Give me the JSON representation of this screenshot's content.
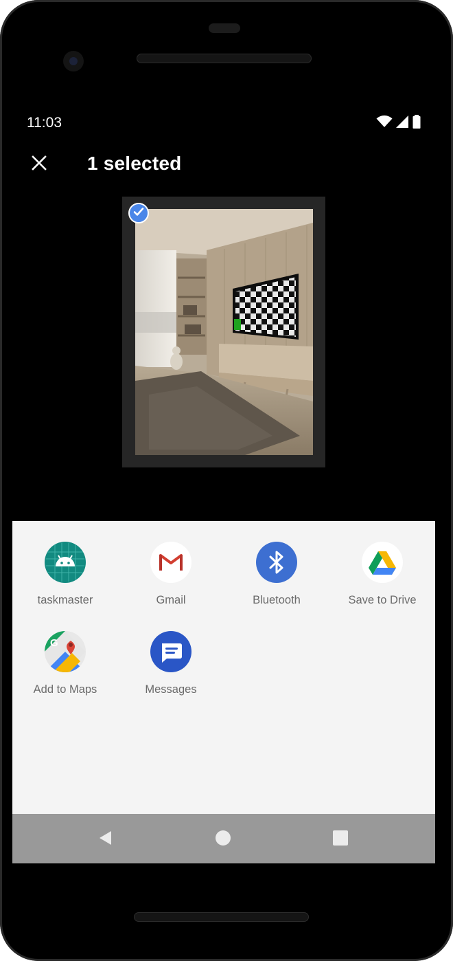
{
  "status_bar": {
    "time": "11:03",
    "icons": [
      "wifi-icon",
      "cellular-signal-icon",
      "battery-icon"
    ]
  },
  "header": {
    "close_icon": "close-icon",
    "title": "1 selected"
  },
  "selection": {
    "selected_count": 1,
    "badge_icon": "checkmark-icon",
    "accent_color": "#4a86e8"
  },
  "share_targets": [
    {
      "label": "taskmaster",
      "icon": "android-app-icon"
    },
    {
      "label": "Gmail",
      "icon": "gmail-icon"
    },
    {
      "label": "Bluetooth",
      "icon": "bluetooth-icon"
    },
    {
      "label": "Save to Drive",
      "icon": "google-drive-icon"
    },
    {
      "label": "Add to Maps",
      "icon": "google-maps-icon"
    },
    {
      "label": "Messages",
      "icon": "messages-icon"
    }
  ],
  "navigation_bar": {
    "buttons": [
      "back-icon",
      "home-icon",
      "recents-icon"
    ]
  },
  "colors": {
    "screen_background": "#000000",
    "sheet_background": "#f4f4f4",
    "navbar_background": "#999999",
    "label_text": "#6b6b6b"
  }
}
